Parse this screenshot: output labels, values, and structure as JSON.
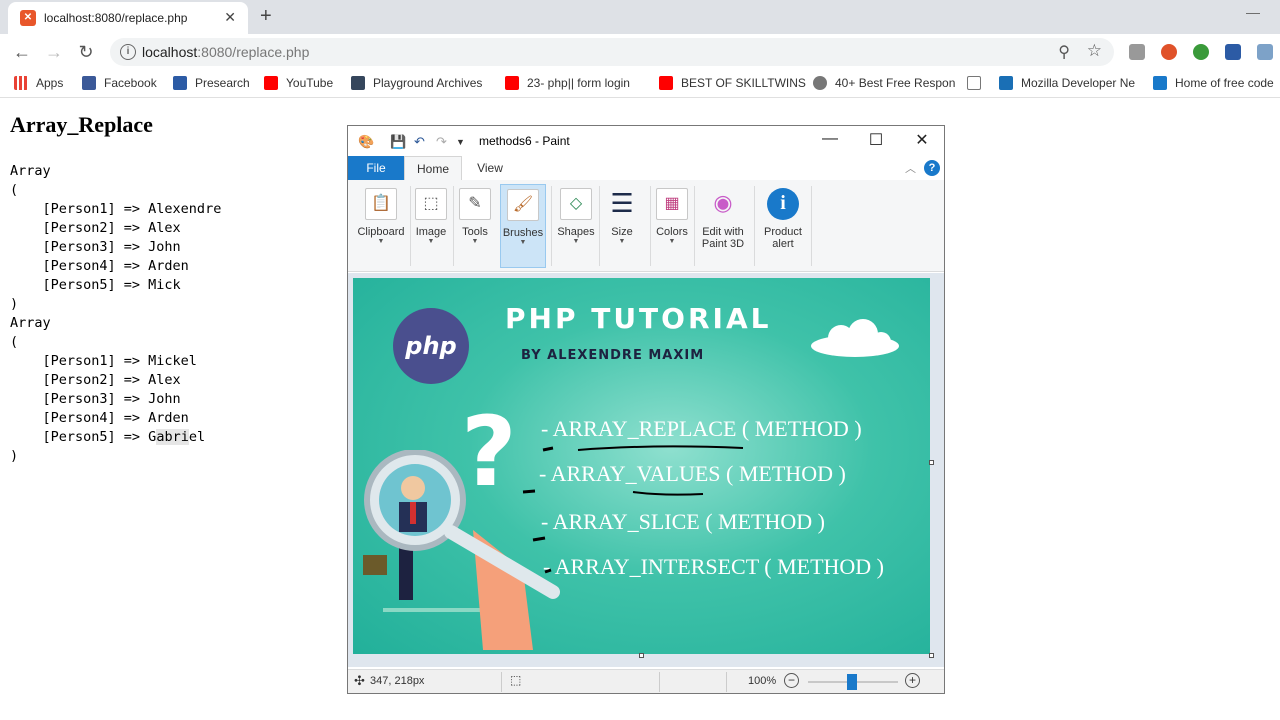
{
  "browser": {
    "tab_title": "localhost:8080/replace.php",
    "url_host": "localhost",
    "url_rest": ":8080/replace.php",
    "bookmarks": [
      {
        "label": "Apps",
        "color": "#4285f4"
      },
      {
        "label": "Facebook",
        "color": "#3b5998"
      },
      {
        "label": "Presearch",
        "color": "#2c5ba5"
      },
      {
        "label": "YouTube",
        "color": "#ff0000"
      },
      {
        "label": "Playground Archives",
        "color": "#35465c"
      },
      {
        "label": "23- php|| form login",
        "color": "#ff0000"
      },
      {
        "label": "BEST OF SKILLTWINS",
        "color": "#ff0000"
      },
      {
        "label": "40+ Best Free Respon",
        "color": "#555555"
      },
      {
        "label": "",
        "color": "#888888"
      },
      {
        "label": "Mozilla Developer Ne",
        "color": "#1a6fb5"
      },
      {
        "label": "Home of free code",
        "color": "#1979ca"
      }
    ]
  },
  "page": {
    "title": "Array_Replace",
    "array1": {
      "open_word": "Array",
      "open_paren": "(",
      "items": [
        "    [Person1] => Alexendre",
        "    [Person2] => Alex",
        "    [Person3] => John",
        "    [Person4] => Arden",
        "    [Person5] => Mick"
      ],
      "close_paren": ")"
    },
    "array2": {
      "open_word": "Array",
      "open_paren": "(",
      "items": [
        "    [Person1] => Mickel",
        "    [Person2] => Alex",
        "    [Person3] => John",
        "    [Person4] => Arden"
      ],
      "last_prefix": "    [Person5] => G",
      "last_highlight": "abri",
      "last_suffix": "el",
      "close_paren": ")"
    }
  },
  "paint": {
    "window_title": "methods6 - Paint",
    "menu": {
      "file": "File",
      "home": "Home",
      "view": "View",
      "help": "?"
    },
    "ribbon": [
      {
        "label": "Clipboard",
        "icon": "clipboard-icon",
        "glyph": "📋"
      },
      {
        "label": "Image",
        "icon": "image-select-icon",
        "glyph": "⬚"
      },
      {
        "label": "Tools",
        "icon": "tools-icon",
        "glyph": "✎"
      },
      {
        "label": "Brushes",
        "icon": "brush-icon",
        "glyph": "🖌"
      },
      {
        "label": "Shapes",
        "icon": "shapes-icon",
        "glyph": "◇"
      },
      {
        "label": "Size",
        "icon": "size-icon",
        "glyph": "☰"
      },
      {
        "label": "Colors",
        "icon": "colors-icon",
        "glyph": "▦"
      },
      {
        "label": "Edit with Paint 3D",
        "icon": "paint3d-icon",
        "glyph": "◉"
      },
      {
        "label": "Product alert",
        "icon": "info-icon",
        "glyph": "i"
      }
    ],
    "image": {
      "php_logo": "php",
      "title": "PHP TUTORIAL",
      "subtitle": "BY ALEXENDRE MAXIM",
      "question": "?",
      "methods": [
        "- ARRAY_REPLACE ( METHOD )",
        "- ARRAY_VALUES ( METHOD )",
        "- ARRAY_SLICE ( METHOD )",
        "- ARRAY_INTERSECT ( METHOD )"
      ],
      "bg_color": "#2bb8a0"
    },
    "status": {
      "coords": "347, 218px",
      "zoom": "100%",
      "zoom_out": "−",
      "zoom_in": "+",
      "zoom_level_percent": 100
    }
  }
}
